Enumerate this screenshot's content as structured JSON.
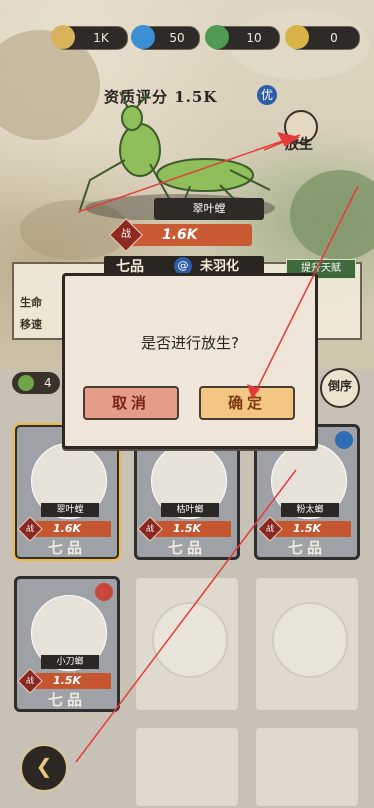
{
  "resources": [
    {
      "value": "1K",
      "color": "#d7b25a",
      "icon": "coin-icon"
    },
    {
      "value": "50",
      "color": "#3c8fd3",
      "icon": "water-drop-icon"
    },
    {
      "value": "10",
      "color": "#4f9b54",
      "icon": "leaf-icon"
    },
    {
      "value": "0",
      "color": "#d8b447",
      "icon": "gold-leaf-icon"
    }
  ],
  "mantis": {
    "rating_label": "资质评分",
    "rating_value": "1.5K",
    "rating_badge": "优",
    "name": "翠叶螳",
    "power_tag": "战",
    "power": "1.6K",
    "rank": "七品",
    "stage": "未羽化",
    "talent_button": "提升天赋",
    "attr_labels": [
      "生命",
      "移速"
    ],
    "release_button": "放生"
  },
  "list": {
    "count": "4",
    "sort_button": "倒序",
    "cards": [
      {
        "name": "翠叶螳",
        "power_tag": "战",
        "power": "1.6K",
        "grade": "七品",
        "selected": true
      },
      {
        "name": "枯叶螂",
        "power_tag": "战",
        "power": "1.5K",
        "grade": "七品",
        "selected": false
      },
      {
        "name": "粉太螂",
        "power_tag": "战",
        "power": "1.5K",
        "grade": "七品",
        "selected": false
      },
      {
        "name": "小刀螂",
        "power_tag": "战",
        "power": "1.5K",
        "grade": "七品",
        "selected": false
      }
    ]
  },
  "dialog": {
    "message": "是否进行放生?",
    "cancel": "取消",
    "confirm": "确定"
  },
  "colors": {
    "accent_orange": "#c95a33",
    "confirm": "#f3c783",
    "cancel": "#e59d88"
  }
}
